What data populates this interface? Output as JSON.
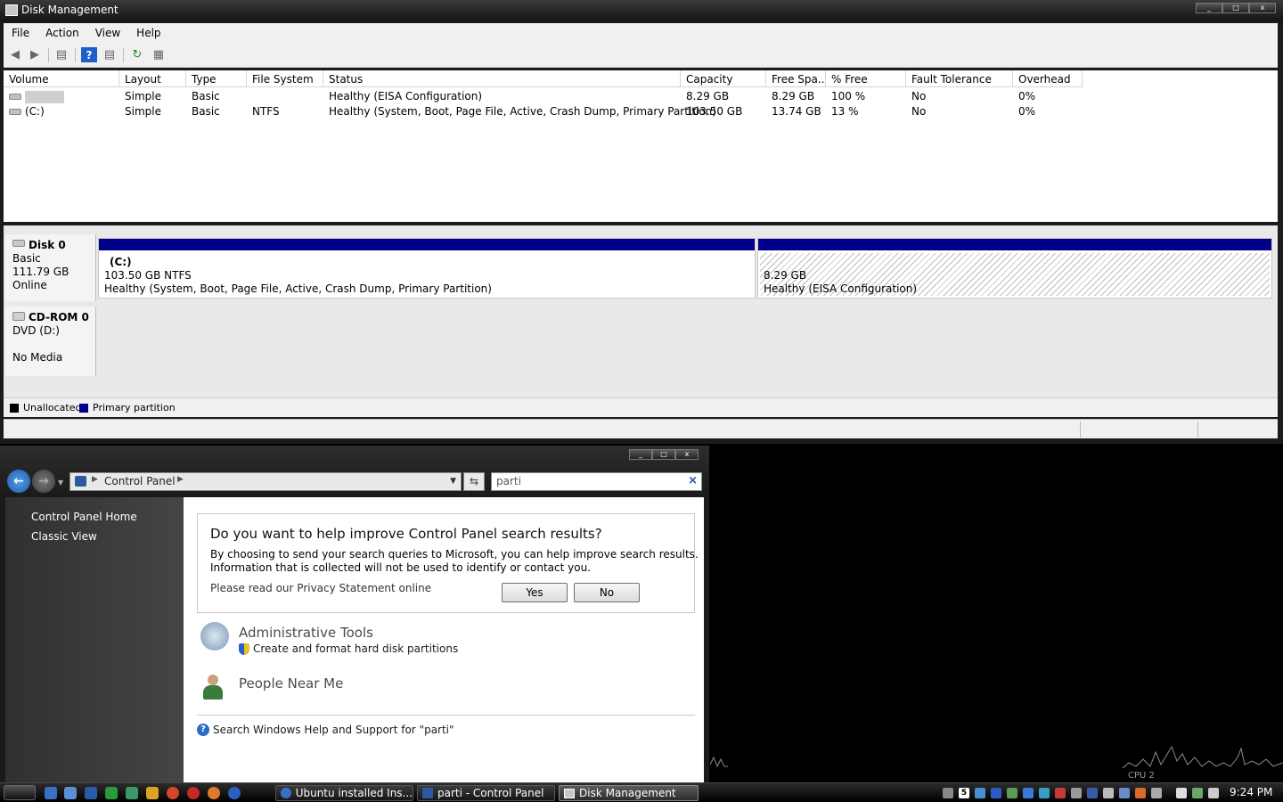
{
  "disk_management": {
    "title": "Disk Management",
    "menu": [
      "File",
      "Action",
      "View",
      "Help"
    ],
    "columns": [
      "Volume",
      "Layout",
      "Type",
      "File System",
      "Status",
      "Capacity",
      "Free Spa...",
      "% Free",
      "Fault Tolerance",
      "Overhead"
    ],
    "rows": [
      {
        "volume": "",
        "layout": "Simple",
        "type": "Basic",
        "fs": "",
        "status": "Healthy (EISA Configuration)",
        "capacity": "8.29 GB",
        "free": "8.29 GB",
        "pct_free": "100 %",
        "fault": "No",
        "overhead": "0%"
      },
      {
        "volume": "(C:)",
        "layout": "Simple",
        "type": "Basic",
        "fs": "NTFS",
        "status": "Healthy (System, Boot, Page File, Active, Crash Dump, Primary Partition)",
        "capacity": "103.50 GB",
        "free": "13.74 GB",
        "pct_free": "13 %",
        "fault": "No",
        "overhead": "0%"
      }
    ],
    "disk0": {
      "name": "Disk 0",
      "kind": "Basic",
      "size": "111.79 GB",
      "state": "Online",
      "partition_c": {
        "name": "(C:)",
        "size_fs": "103.50 GB NTFS",
        "status": "Healthy (System, Boot, Page File, Active, Crash Dump, Primary Partition)"
      },
      "partition_eisa": {
        "size": "8.29 GB",
        "status": "Healthy (EISA Configuration)"
      }
    },
    "cdrom0": {
      "name": "CD-ROM 0",
      "kind": "DVD (D:)",
      "state": "No Media"
    },
    "legend": {
      "unallocated": "Unallocated",
      "primary": "Primary partition"
    },
    "colors": {
      "primary_partition": "#00008b",
      "unallocated": "#000000"
    }
  },
  "control_panel": {
    "breadcrumb": "Control Panel",
    "search_value": "parti",
    "sidebar": [
      "Control Panel Home",
      "Classic View"
    ],
    "infobox": {
      "title": "Do you want to help improve Control Panel search results?",
      "line1": "By choosing to send your search queries to Microsoft, you can help improve search results.",
      "line2": "Information that is collected will not be used to identify or contact you.",
      "privacy": "Please read our Privacy Statement online",
      "yes": "Yes",
      "no": "No"
    },
    "results": [
      {
        "title": "Administrative Tools",
        "link": "Create and format hard disk partitions"
      },
      {
        "title": "People Near Me"
      }
    ],
    "help_search": "Search Windows Help and Support for \"parti\""
  },
  "taskbar": {
    "buttons": [
      "Ubuntu installed Ins...",
      "parti - Control Panel",
      "Disk Management"
    ],
    "clock": "9:24 PM"
  },
  "desktop": {
    "cpu_label": "CPU 2"
  }
}
